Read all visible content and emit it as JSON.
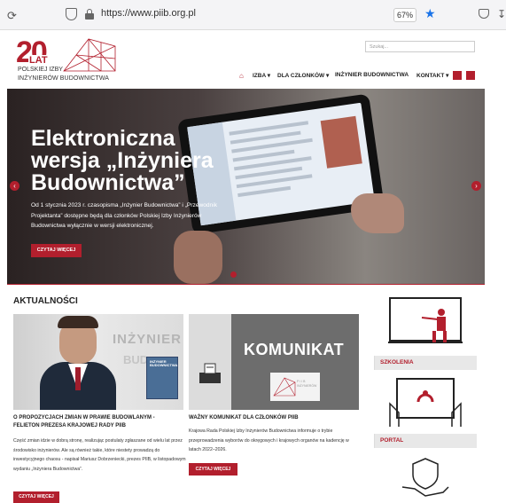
{
  "browser": {
    "url": "https://www.piib.org.pl",
    "zoom": "67%"
  },
  "logo": {
    "number": "20",
    "lat": "LAT",
    "line1": "POLSKIEJ IZBY",
    "line2": "INŻYNIERÓW BUDOWNICTWA"
  },
  "search": {
    "placeholder": "Szukaj..."
  },
  "nav": {
    "items": [
      "IZBA",
      "DLA CZŁONKÓW",
      "INŻYNIER BUDOWNICTWA",
      "KONTAKT"
    ]
  },
  "hero": {
    "title": "Elektroniczna wersja „Inżyniera Budownictwa”",
    "text": "Od 1 stycznia 2023 r. czasopisma „Inżynier Budownictwa” i „Przewodnik Projektanta” dostępne będą dla członków Polskiej Izby Inżynierów Budownictwa wyłącznie w wersji elektronicznej.",
    "button": "CZYTAJ WIĘCEJ"
  },
  "section": {
    "title": "AKTUALNOŚCI"
  },
  "news": [
    {
      "image_text": "INŻYNIER",
      "image_text2": "BUD",
      "magazine": "INŻYNIER BUDOWNICTWA",
      "title": "O PROPOZYCJACH ZMIAN W PRAWIE BUDOWLANYM - FELIETON PREZESA KRAJOWEJ RADY PIIB",
      "text": "Część zmian idzie w dobrą stronę, realizując postulaty zgłaszane od wielu lat przez środowisko inżynierów. Ale są również takie, które niestety prowadzą do inwestycyjnego chaosu - napisał Mariusz Dobrzeniecki, prezes PIIB, w listopadowym wydaniu „Inżyniera Budownictwa”.",
      "button": "CZYTAJ WIĘCEJ"
    },
    {
      "image_title": "KOMUNIKAT",
      "card_text": "P I I B INŻYNIERÓW",
      "title": "WAŻNY KOMUNIKAT DLA CZŁONKÓW PIIB",
      "text": "Krajowa Rada Polskiej Izby Inżynierów Budownictwa informuje o trybie przeprowadzenia wyborów do okręgowych i krajowych organów na kadencję w latach 2022–2026.",
      "button": "CZYTAJ WIĘCEJ"
    }
  ],
  "sidebar": {
    "items": [
      {
        "label": "SZKOLENIA",
        "icon": "presentation-icon"
      },
      {
        "label": "PORTAL",
        "icon": "portal-icon"
      },
      {
        "label": "",
        "icon": "shield-hand-icon"
      }
    ]
  },
  "colors": {
    "accent": "#b21f2d",
    "hero_bg": "#3a3030"
  }
}
